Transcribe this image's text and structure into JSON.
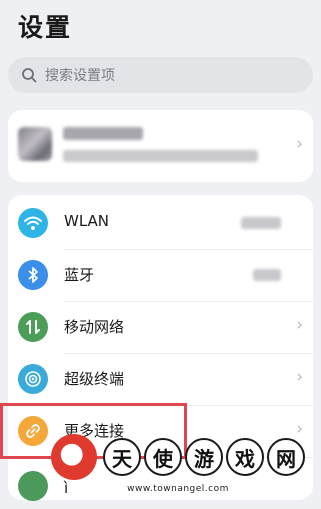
{
  "page": {
    "title": "设置"
  },
  "search": {
    "placeholder": "搜索设置项"
  },
  "settings": {
    "items": [
      {
        "label": "WLAN",
        "icon": "wifi-icon",
        "color": "#2fb4e6"
      },
      {
        "label": "蓝牙",
        "icon": "bluetooth-icon",
        "color": "#3a8fe8"
      },
      {
        "label": "移动网络",
        "icon": "mobile-data-icon",
        "color": "#4c9d58"
      },
      {
        "label": "超级终端",
        "icon": "super-device-icon",
        "color": "#3aaad9"
      },
      {
        "label": "更多连接",
        "icon": "link-icon",
        "color": "#f3a839"
      }
    ],
    "partial_item_label": "ì"
  },
  "watermark": {
    "chars": [
      "天",
      "使",
      "游",
      "戏",
      "网"
    ],
    "url": "www.townangel.com"
  }
}
